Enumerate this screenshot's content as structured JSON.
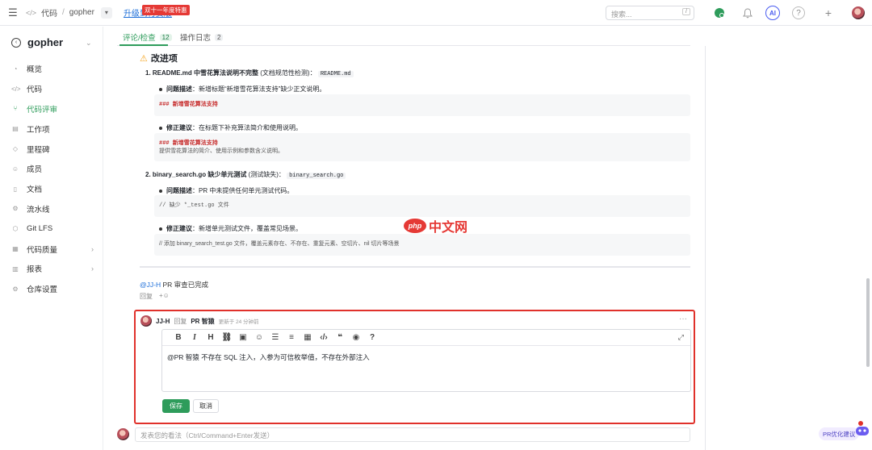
{
  "topbar": {
    "breadcrumb_code": "代码",
    "breadcrumb_sep": "/",
    "breadcrumb_repo": "gopher",
    "upgrade_link": "升级到付费版",
    "promo_badge": "双十一年度特惠",
    "search_placeholder": "搜索...",
    "search_shortcut": "/",
    "ai_label": "AI"
  },
  "sidebar": {
    "project_name": "gopher",
    "items": [
      {
        "label": "概览"
      },
      {
        "label": "代码"
      },
      {
        "label": "代码评审"
      },
      {
        "label": "工作项"
      },
      {
        "label": "里程碑"
      },
      {
        "label": "成员"
      },
      {
        "label": "文档"
      },
      {
        "label": "流水线"
      },
      {
        "label": "Git LFS"
      },
      {
        "label": "代码质量"
      },
      {
        "label": "报表"
      },
      {
        "label": "仓库设置"
      }
    ]
  },
  "tabs": [
    {
      "label": "评论/检查",
      "count": "12"
    },
    {
      "label": "操作日志",
      "count": "2"
    }
  ],
  "review": {
    "section_title": "改进项",
    "item1": {
      "title": "1. README.md 中雪花算法说明不完整",
      "suffix": "(文档规范性检测)：",
      "file": "README.md",
      "problem_label": "问题描述",
      "problem_text": "：新增标题“新增雪花算法支持”缺少正文说明。",
      "problem_code": "### 新增雪花算法支持",
      "fix_label": "修正建议",
      "fix_text": "：在标题下补充算法简介和使用说明。",
      "fix_code_h": "### 新增雪花算法支持",
      "fix_code_body": "提供雪花算法的简介、使用示例和参数含义说明。"
    },
    "item2": {
      "title": "2. binary_search.go 缺少单元测试",
      "suffix": "(测试缺失)：",
      "file": "binary_search.go",
      "problem_label": "问题描述",
      "problem_text": "：PR 中未提供任何单元测试代码。",
      "problem_code": "// 缺少 *_test.go 文件",
      "fix_label": "修正建议",
      "fix_text": "：新增单元测试文件，覆盖常见场景。",
      "fix_code": "// 添加 binary_search_test.go 文件，覆盖元素存在、不存在、重复元素、空切片、nil 切片等场景"
    },
    "done_mention": "@JJ-H",
    "done_text": " PR 审查已完成",
    "reply_label": "回复",
    "react_label": "+☺"
  },
  "reply_card": {
    "user": "JJ-H",
    "reply_word": "回复",
    "target": "PR 智猿",
    "updated": "更新于 24 分钟前",
    "more": "···",
    "editor_text": "@PR 智猿  不存在 SQL 注入，入参为可信枚举值，不存在外部注入",
    "save_label": "保存",
    "cancel_label": "取消"
  },
  "bottom": {
    "comment_placeholder": "发表您的看法（Ctrl/Command+Enter发送）"
  },
  "floating": {
    "pr_opt_label": "PR优化建议",
    "watermark_logo": "php",
    "watermark_text": "中文网"
  },
  "colors": {
    "accent": "#2e9c5b",
    "highlight_border": "#e0312b",
    "link": "#1e6fd9"
  }
}
